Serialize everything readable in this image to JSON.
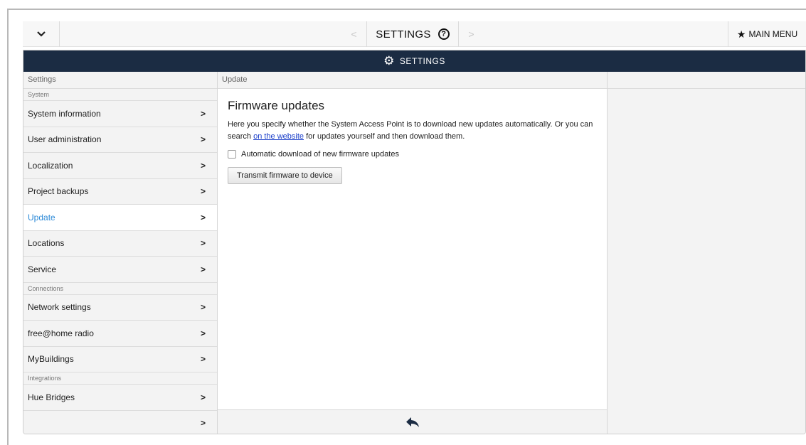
{
  "topbar": {
    "title": "SETTINGS",
    "help_symbol": "?",
    "prev_symbol": "<",
    "next_symbol": ">",
    "main_menu_label": "MAIN MENU",
    "main_menu_icon": "star-icon"
  },
  "header": {
    "title": "SETTINGS",
    "icon": "gear-icon"
  },
  "sidebar": {
    "heading": "Settings",
    "sections": [
      {
        "label": "System",
        "items": [
          {
            "label": "System information"
          },
          {
            "label": "User administration"
          },
          {
            "label": "Localization"
          },
          {
            "label": "Project backups"
          },
          {
            "label": "Update",
            "active": true
          },
          {
            "label": "Locations"
          },
          {
            "label": "Service"
          }
        ]
      },
      {
        "label": "Connections",
        "items": [
          {
            "label": "Network settings"
          },
          {
            "label": "free@home radio"
          },
          {
            "label": "MyBuildings"
          }
        ]
      },
      {
        "label": "Integrations",
        "items": [
          {
            "label": "Hue Bridges"
          },
          {
            "label": ""
          }
        ]
      }
    ],
    "chevron": ">"
  },
  "content": {
    "heading": "Update",
    "title": "Firmware updates",
    "desc_part1": "Here you specify whether the System Access Point is to download new updates automatically. Or you can search ",
    "desc_link": "on the website",
    "desc_part2": " for updates yourself and then download them.",
    "checkbox_label": "Automatic download of new firmware updates",
    "checkbox_checked": false,
    "button_label": "Transmit firmware to device",
    "back_icon": "back-arrow-icon"
  },
  "colors": {
    "header_bg": "#1b2c43",
    "active_text": "#2e8bd8",
    "link": "#1a3ec9"
  }
}
